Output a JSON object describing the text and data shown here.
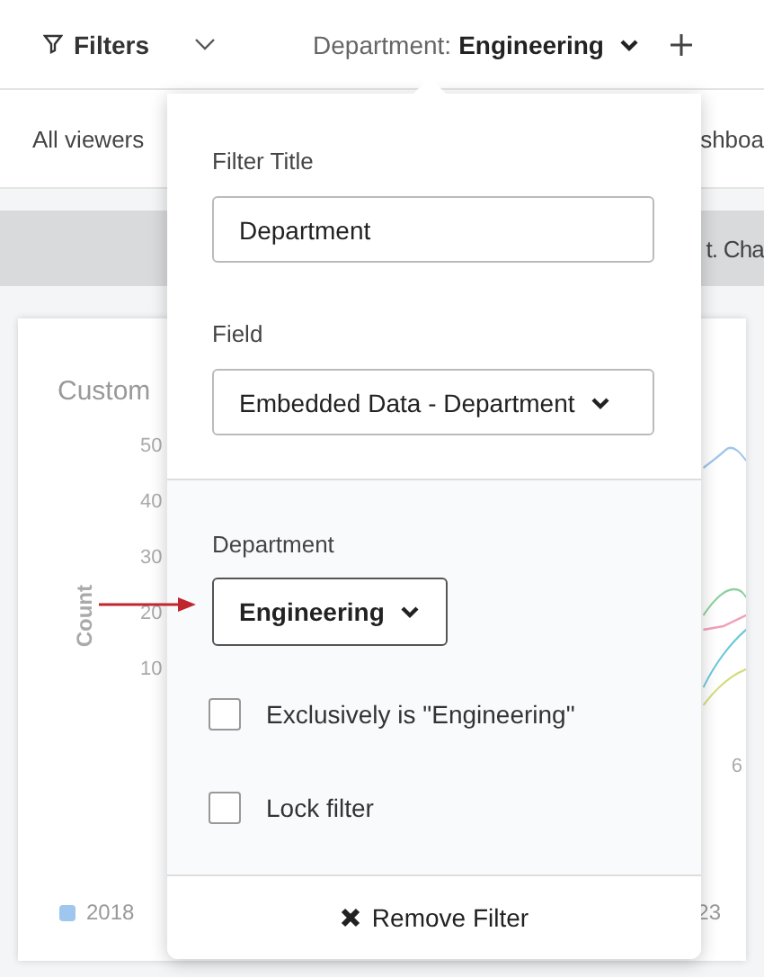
{
  "toolbar": {
    "filters_label": "Filters",
    "active_filter": {
      "name": "Department:",
      "value": "Engineering"
    }
  },
  "subbar": {
    "left": "All viewers",
    "right": "shboa"
  },
  "banner": {
    "text": "t. Cha"
  },
  "chart_card": {
    "title": "Custom",
    "axis_label": "Count",
    "y_ticks": [
      "50",
      "40",
      "30",
      "20",
      "10"
    ],
    "x_tick": "6",
    "legend": [
      {
        "label": "2018",
        "color": "#9fc6ee"
      }
    ],
    "legend_end": "23"
  },
  "popover": {
    "title_label": "Filter Title",
    "title_value": "Department",
    "field_label": "Field",
    "field_value": "Embedded Data - Department",
    "value_label": "Department",
    "value_selected": "Engineering",
    "options": [
      {
        "label": "Exclusively is \"Engineering\"",
        "checked": false
      },
      {
        "label": "Lock filter",
        "checked": false
      }
    ],
    "remove_label": "Remove Filter"
  }
}
